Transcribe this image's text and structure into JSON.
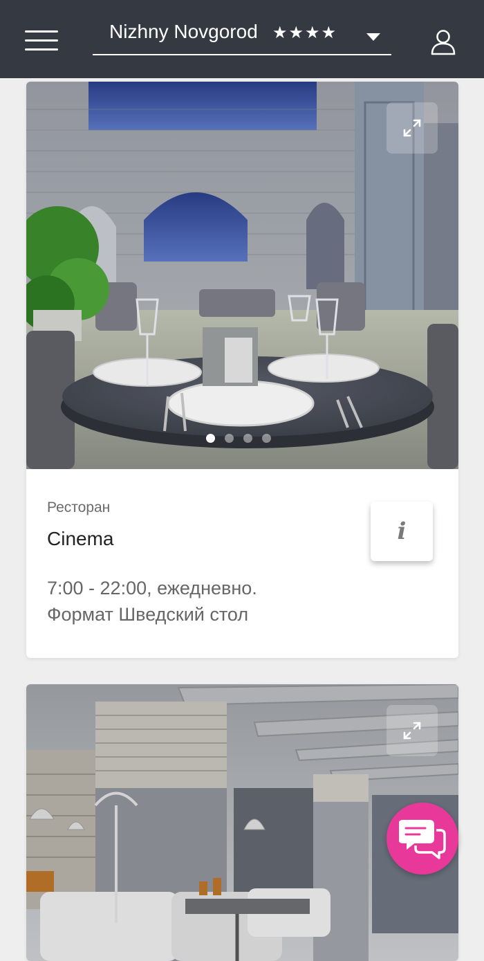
{
  "header": {
    "menu_icon": "hamburger-menu-icon",
    "hotel_name": "Nizhny Novgorod",
    "hotel_stars": "★★★★",
    "dropdown_icon": "caret-down-icon",
    "profile_icon": "user-icon"
  },
  "cards": [
    {
      "category": "Ресторан",
      "title": "Cinema",
      "hours": "7:00 - 22:00, ежедневно.",
      "format": "Формат Шведский стол",
      "expand_icon": "expand-icon",
      "info_label": "i",
      "gallery": {
        "count": 4,
        "active": 1
      }
    },
    {
      "expand_icon": "expand-icon"
    }
  ],
  "chat": {
    "icon": "chat-bubbles-icon",
    "color": "#e8399a"
  },
  "colors": {
    "header_bg": "#353a42",
    "page_bg": "#eeeeee",
    "accent": "#e8399a"
  }
}
